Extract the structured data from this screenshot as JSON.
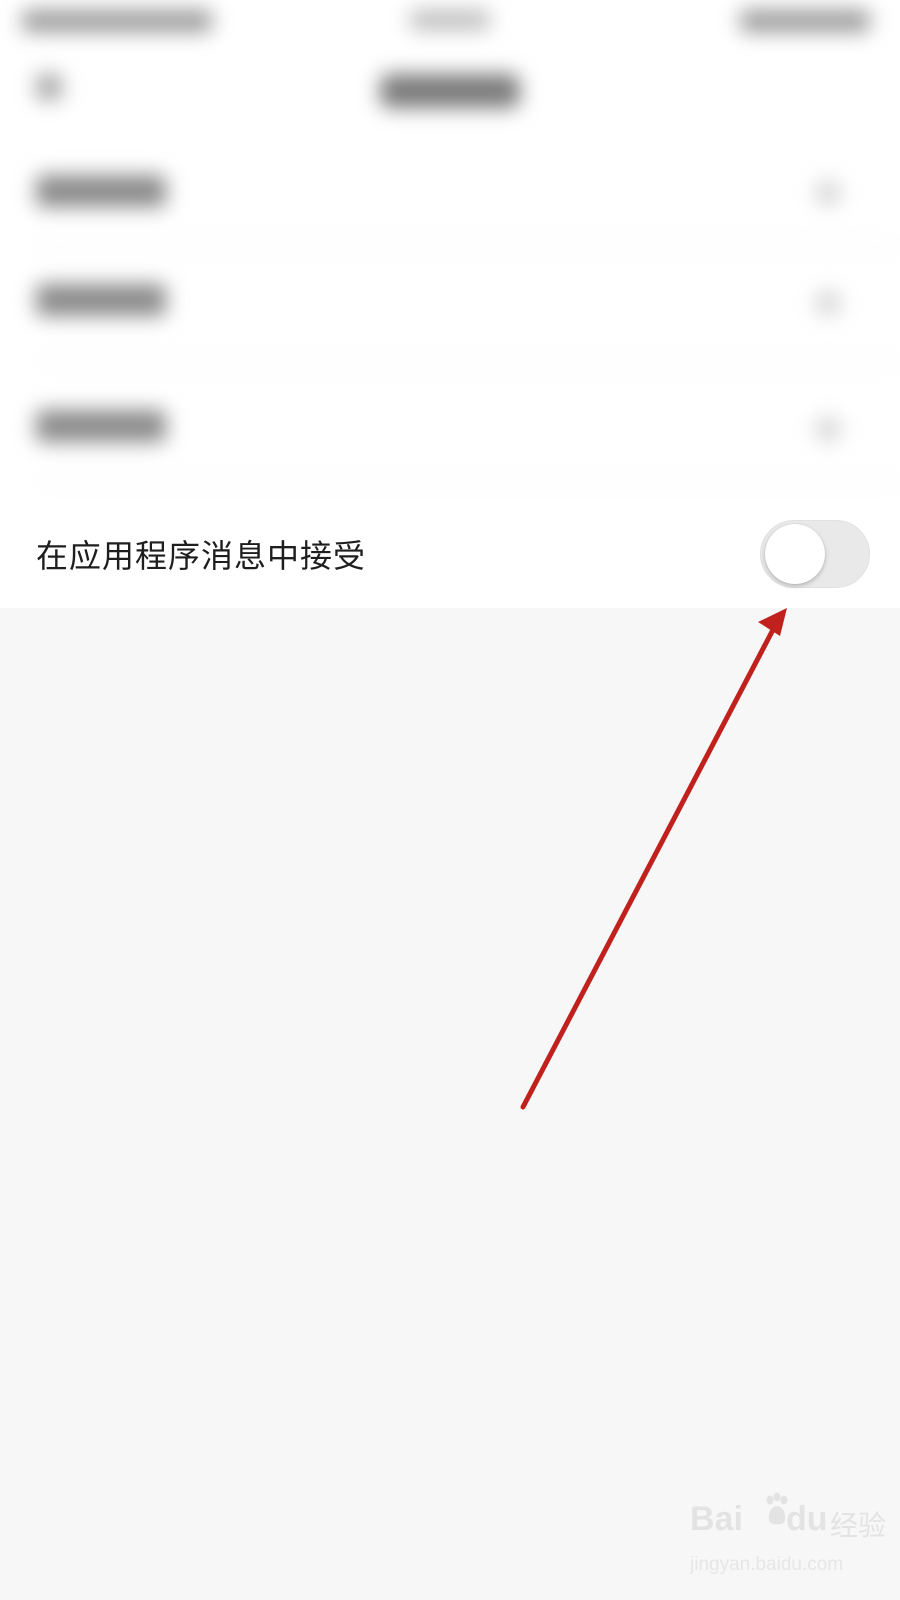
{
  "setting": {
    "label": "在应用程序消息中接受",
    "toggle_on": false
  },
  "annotation": {
    "arrow_color": "#c0211d"
  },
  "watermark": {
    "brand": "Bai",
    "brand_tail": "du",
    "cn": "经验",
    "url": "jingyan.baidu.com"
  },
  "colors": {
    "background": "#f7f7f7",
    "row_background": "#ffffff",
    "toggle_track_off": "#e9e9ea",
    "text": "#1e1e1e"
  }
}
